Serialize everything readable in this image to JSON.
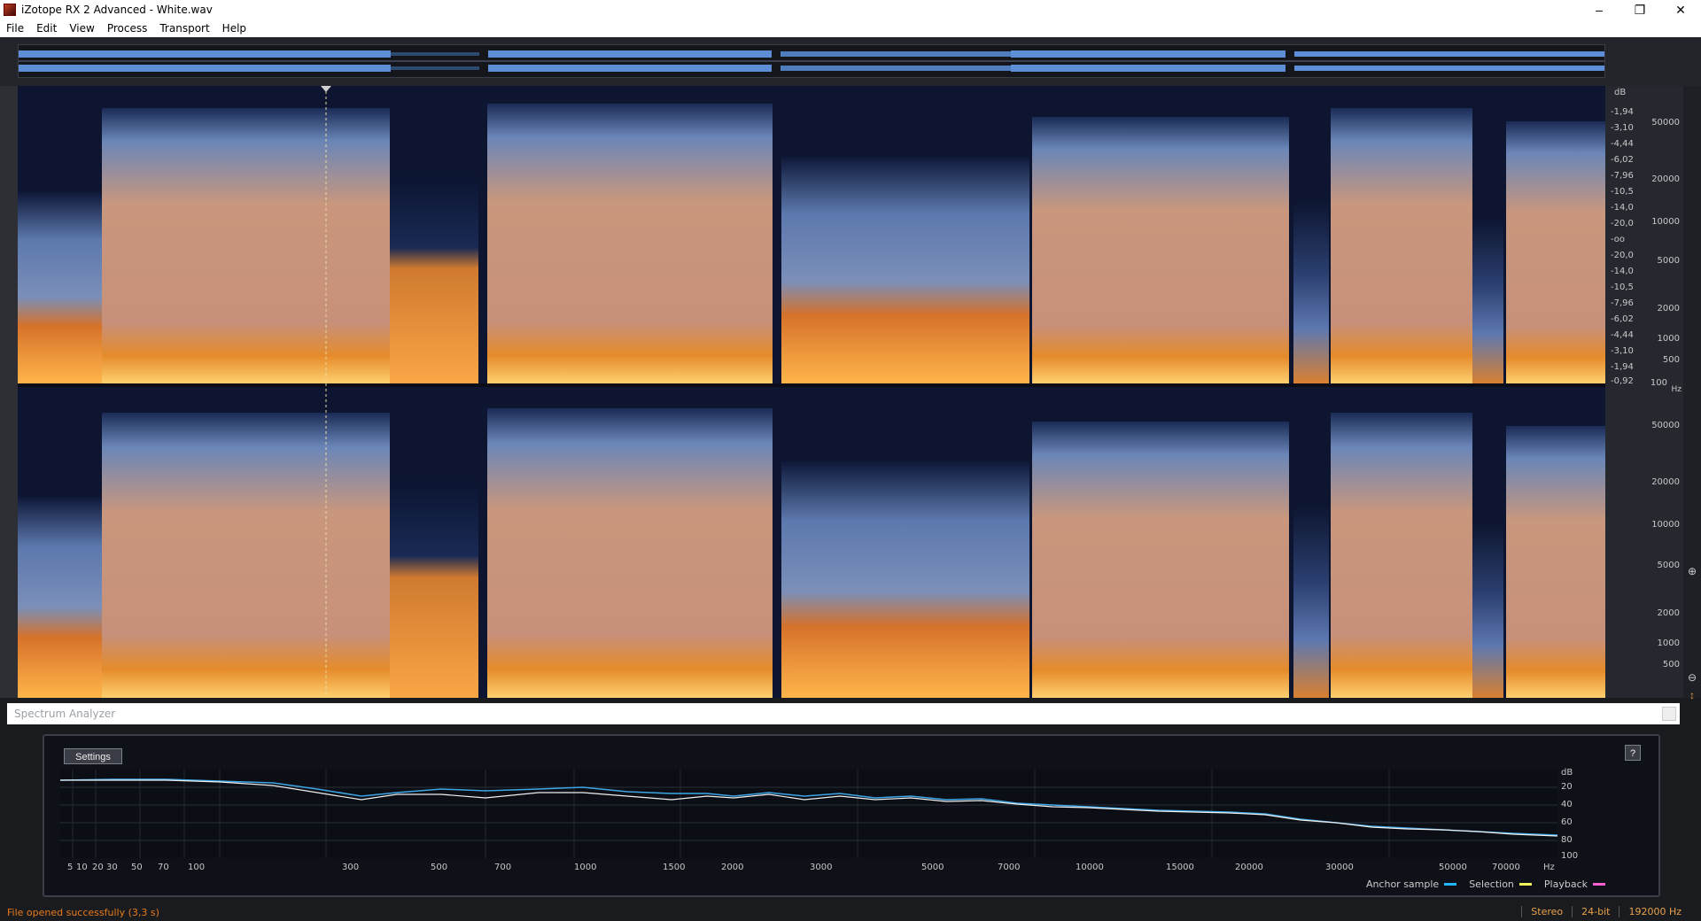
{
  "window": {
    "title": "iZotope RX 2 Advanced - White.wav",
    "minimize_glyph": "–",
    "maximize_glyph": "❐",
    "close_glyph": "✕"
  },
  "menu": {
    "items": [
      "File",
      "Edit",
      "View",
      "Process",
      "Transport",
      "Help"
    ]
  },
  "spectrogram": {
    "db_unit": "dB",
    "db_ticks": [
      "-1,94",
      "-3,10",
      "-4,44",
      "-6,02",
      "-7,96",
      "-10,5",
      "-14,0",
      "-20,0",
      "-oo",
      "-20,0",
      "-14,0",
      "-10,5",
      "-7,96",
      "-6,02",
      "-4,44",
      "-3,10",
      "-1,94",
      "-0,92"
    ],
    "hz_ticks": [
      "50000",
      "20000",
      "10000",
      "5000",
      "2000",
      "1000",
      "500",
      "100"
    ],
    "hz_unit": "Hz"
  },
  "spectrum_analyzer": {
    "title": "Spectrum Analyzer",
    "settings_label": "Settings",
    "help_label": "?",
    "x_ticks": [
      "5",
      "10",
      "20",
      "30",
      "50",
      "70",
      "100",
      "300",
      "500",
      "700",
      "1000",
      "1500",
      "2000",
      "3000",
      "5000",
      "7000",
      "10000",
      "15000",
      "20000",
      "30000",
      "50000",
      "70000",
      "Hz"
    ],
    "y_unit": "dB",
    "y_ticks": [
      "20",
      "40",
      "60",
      "80",
      "100"
    ],
    "legend": [
      {
        "label": "Anchor sample",
        "color": "#1fb7ff"
      },
      {
        "label": "Selection",
        "color": "#f2f25a"
      },
      {
        "label": "Playback",
        "color": "#ff5fd0"
      }
    ],
    "colors": {
      "anchor": "#3da6e6",
      "selection": "#f0f0f0"
    }
  },
  "status": {
    "message": "File opened successfully (3,3 s)",
    "channels": "Stereo",
    "bit_depth": "24-bit",
    "sample_rate": "192000 Hz"
  }
}
